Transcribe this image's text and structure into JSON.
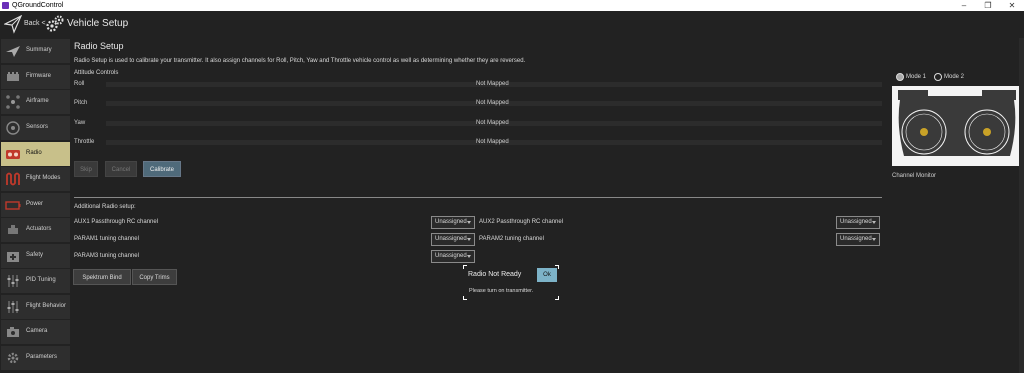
{
  "window": {
    "title": "QGroundControl",
    "controls": [
      "minimize",
      "maximize",
      "close"
    ]
  },
  "toolbar": {
    "back_label": "Back",
    "back_chevron": "<",
    "page_title": "Vehicle Setup"
  },
  "sidebar": {
    "items": [
      {
        "label": "Summary",
        "icon": "plane-icon",
        "active": false
      },
      {
        "label": "Firmware",
        "icon": "firmware-icon",
        "active": false
      },
      {
        "label": "Airframe",
        "icon": "airframe-icon",
        "active": false
      },
      {
        "label": "Sensors",
        "icon": "sensors-icon",
        "active": false
      },
      {
        "label": "Radio",
        "icon": "radio-icon",
        "active": true
      },
      {
        "label": "Flight Modes",
        "icon": "flight-modes-icon",
        "active": false
      },
      {
        "label": "Power",
        "icon": "battery-icon",
        "active": false
      },
      {
        "label": "Actuators",
        "icon": "actuators-icon",
        "active": false
      },
      {
        "label": "Safety",
        "icon": "safety-icon",
        "active": false
      },
      {
        "label": "PID Tuning",
        "icon": "pid-tuning-icon",
        "active": false
      },
      {
        "label": "Flight Behavior",
        "icon": "flight-behavior-icon",
        "active": false
      },
      {
        "label": "Camera",
        "icon": "camera-icon",
        "active": false
      },
      {
        "label": "Parameters",
        "icon": "parameters-icon",
        "active": false
      }
    ]
  },
  "main": {
    "title": "Radio Setup",
    "description": "Radio Setup is used to calibrate your transmitter. It also assign channels for Roll, Pitch, Yaw and Throttle vehicle control as well as determining whether they are reversed.",
    "attitude_header": "Attitude Controls",
    "axes": [
      {
        "label": "Roll",
        "value": "Not Mapped"
      },
      {
        "label": "Pitch",
        "value": "Not Mapped"
      },
      {
        "label": "Yaw",
        "value": "Not Mapped"
      },
      {
        "label": "Throttle",
        "value": "Not Mapped"
      }
    ],
    "buttons": {
      "skip": "Skip",
      "cancel": "Cancel",
      "calibrate": "Calibrate"
    },
    "additional_header": "Additional Radio setup:",
    "options": [
      {
        "label": "AUX1 Passthrough RC channel",
        "value": "Unassigned"
      },
      {
        "label": "AUX2 Passthrough RC channel",
        "value": "Unassigned"
      },
      {
        "label": "PARAM1 tuning channel",
        "value": "Unassigned"
      },
      {
        "label": "PARAM2 tuning channel",
        "value": "Unassigned"
      },
      {
        "label": "PARAM3 tuning channel",
        "value": "Unassigned"
      }
    ],
    "bind_buttons": {
      "spektrum": "Spektrum Bind",
      "copy_trims": "Copy Trims"
    }
  },
  "popup": {
    "title": "Radio Not Ready",
    "ok": "Ok",
    "message": "Please turn on transmitter."
  },
  "monitor": {
    "modes": [
      "Mode 1",
      "Mode 2"
    ],
    "selected_mode": "Mode 1",
    "label": "Channel Monitor"
  },
  "colors": {
    "active_tab": "#c8c08a",
    "calibrate": "#4f6a7a",
    "ok_button": "#7db3c8",
    "stick_dot": "#c9a227"
  }
}
